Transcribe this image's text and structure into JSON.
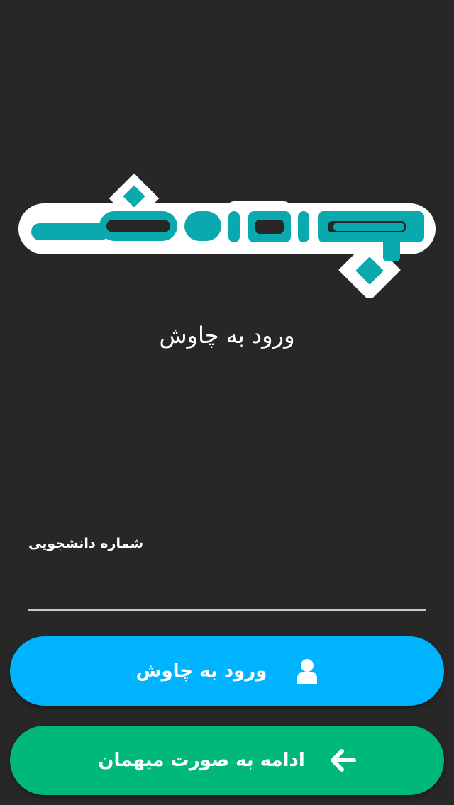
{
  "brand": {
    "logo_text": "چاوش",
    "logo_color": "#0aa9ad"
  },
  "heading": {
    "title": "ورود به چاوش"
  },
  "form": {
    "student_number_label": "شماره دانشجویی",
    "student_number_value": ""
  },
  "buttons": {
    "login_label": "ورود به چاوش",
    "login_icon": "user-icon",
    "guest_label": "ادامه به صورت میهمان",
    "guest_icon": "arrow-left-icon"
  },
  "colors": {
    "background": "#272727",
    "login_button": "#00b3ff",
    "guest_button": "#00b87a",
    "input_underline": "#c9c9c9"
  }
}
